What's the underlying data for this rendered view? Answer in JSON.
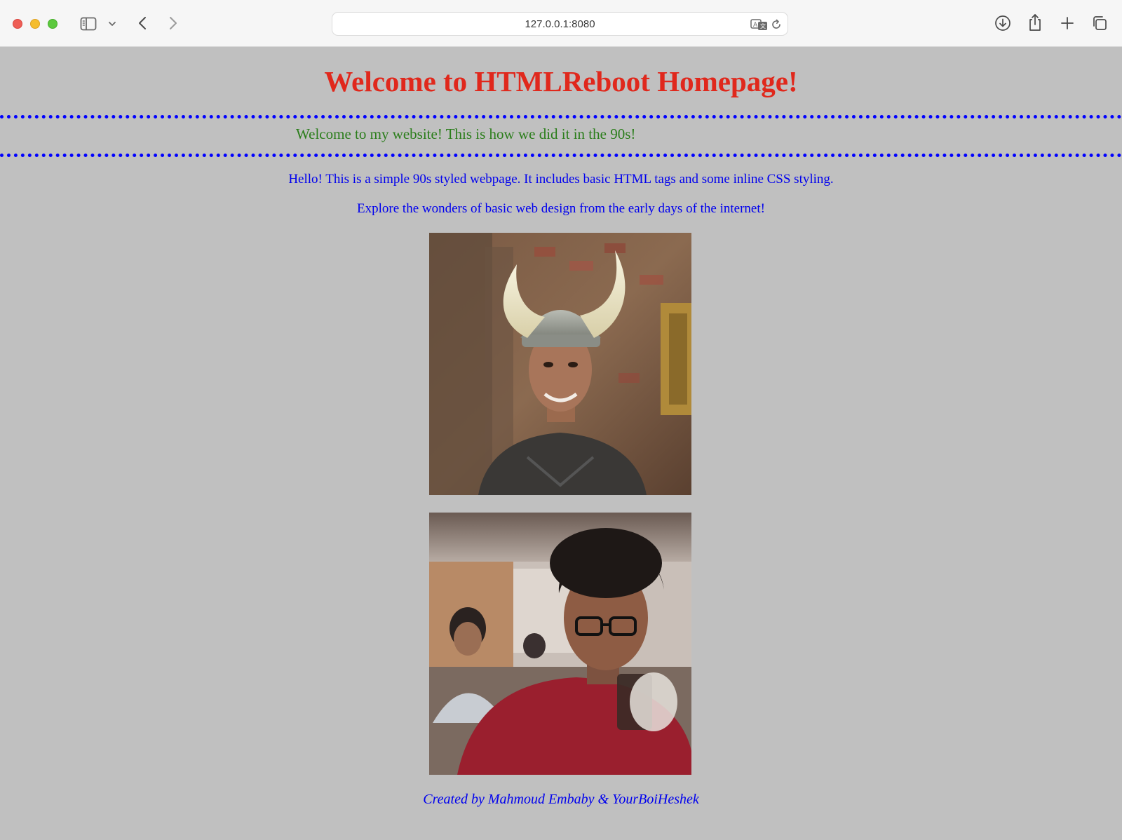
{
  "browser": {
    "url": "127.0.0.1:8080",
    "icons": {
      "sidebar": "sidebar-icon",
      "sidebar_menu": "chevron-down-icon",
      "back": "chevron-left-icon",
      "forward": "chevron-right-icon",
      "translate": "translate-icon",
      "reload": "reload-icon",
      "downloads": "download-icon",
      "share": "share-icon",
      "new_tab": "plus-icon",
      "tab_overview": "tabs-icon"
    }
  },
  "page": {
    "heading": "Welcome to HTMLReboot Homepage!",
    "marquee": "Welcome to my website! This is how we did it in the 90s!",
    "intro": "Hello! This is a simple 90s styled webpage. It includes basic HTML tags and some inline CSS styling.",
    "explore": "Explore the wonders of basic web design from the early days of the internet!",
    "footer": "Created by Mahmoud Embaby & YourBoiHeshek",
    "colors": {
      "background": "#c0c0c0",
      "heading": "#e0281c",
      "marquee_text": "#2a7d1a",
      "marquee_border": "#0000ff",
      "body_text": "#0000ee"
    }
  }
}
